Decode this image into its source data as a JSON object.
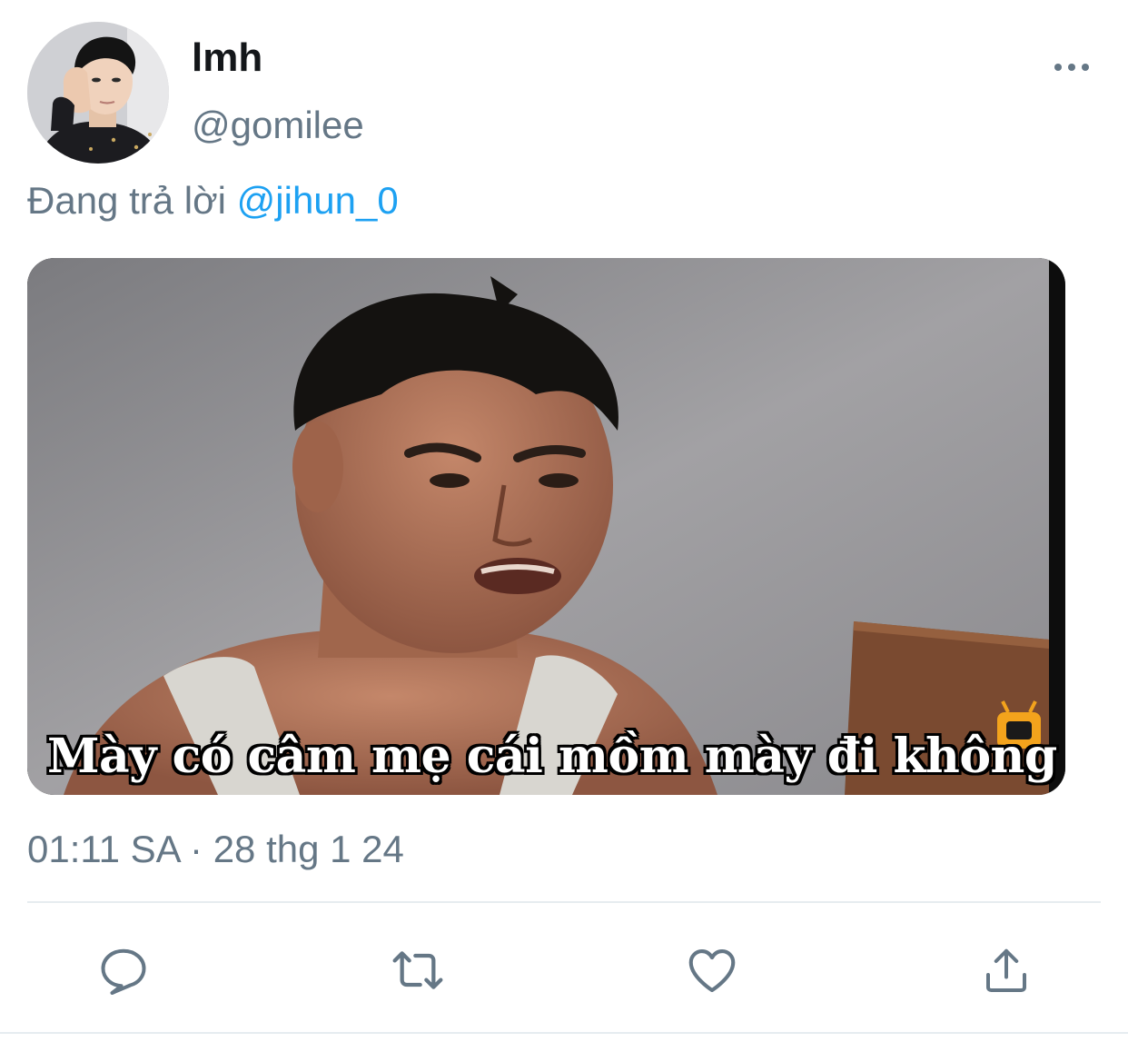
{
  "tweet": {
    "display_name": "lmh",
    "handle": "@gomilee",
    "reply_prefix": "Đang trả lời",
    "reply_mention": "@jihun_0",
    "media_caption": "Mày có câm mẹ cái mồm mày đi không",
    "timestamp": "01:11 SA · 28 thg 1 24"
  },
  "icons": {
    "more": "more-horizontal-icon",
    "reply": "reply-icon",
    "retweet": "retweet-icon",
    "like": "heart-icon",
    "share": "share-icon"
  },
  "colors": {
    "accent": "#1da1f2",
    "secondary_text": "#657786",
    "primary_text": "#14171a",
    "divider": "#e6ecf0"
  }
}
